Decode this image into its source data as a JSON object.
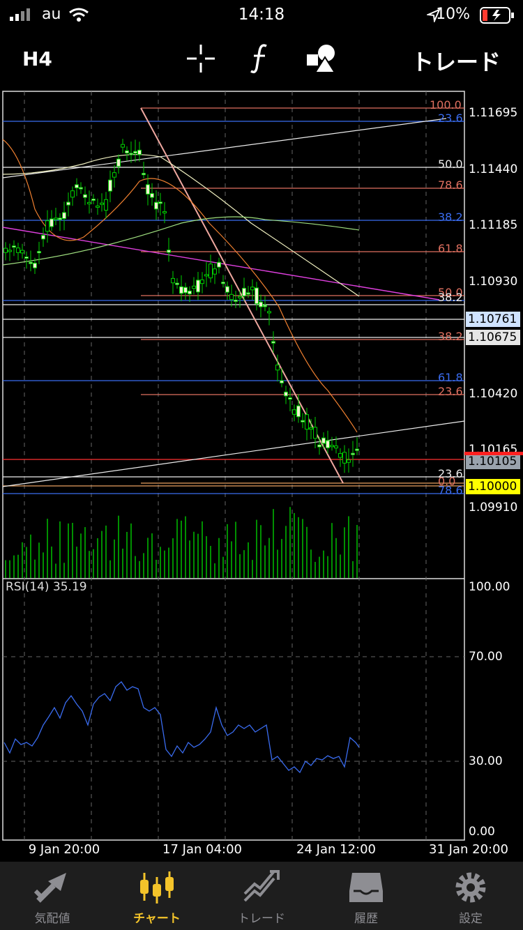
{
  "status_bar": {
    "carrier": "au",
    "time": "14:18",
    "battery": "10%"
  },
  "toolbar": {
    "timeframe": "H4",
    "trade_label": "トレード",
    "icons": [
      "crosshair-icon",
      "function-icon",
      "objects-icon"
    ]
  },
  "price_axis": {
    "ticks": [
      "1.11695",
      "1.11440",
      "1.11185",
      "1.10930",
      "1.10675",
      "1.10420",
      "1.10165",
      "1.09910"
    ],
    "highlights": [
      {
        "value": "1.10761",
        "bg": "#cfe3ff",
        "fg": "#000000"
      },
      {
        "value": "1.10675",
        "bg": "#e6e6e6",
        "fg": "#000000"
      },
      {
        "value": "1.10105",
        "bg": "#9aa3ad",
        "fg": "#000000"
      },
      {
        "value": "1.10000",
        "bg": "#ffff00",
        "fg": "#000000"
      }
    ]
  },
  "fib_labels": [
    "100.0",
    "23.6",
    "50.0",
    "78.6",
    "38.2",
    "61.8",
    "50.0",
    "38.2",
    "38.2",
    "61.8",
    "23.6",
    "23.6",
    "0.0",
    "78.6"
  ],
  "rsi": {
    "label": "RSI(14) 35.19",
    "ticks": [
      "100.00",
      "70.00",
      "30.00",
      "0.00"
    ]
  },
  "time_axis": {
    "ticks": [
      "9 Jan 20:00",
      "17 Jan 04:00",
      "24 Jan 12:00",
      "31 Jan 20:00"
    ]
  },
  "tabs": [
    {
      "label": "気配値",
      "icon": "quotes-icon",
      "active": false
    },
    {
      "label": "チャート",
      "icon": "chart-icon",
      "active": true
    },
    {
      "label": "トレード",
      "icon": "trade-icon",
      "active": false
    },
    {
      "label": "履歴",
      "icon": "history-icon",
      "active": false
    },
    {
      "label": "設定",
      "icon": "settings-icon",
      "active": false
    }
  ],
  "colors": {
    "accent": "#f4c42a",
    "candle": "#00d000",
    "rsi": "#3a6cf0"
  }
}
